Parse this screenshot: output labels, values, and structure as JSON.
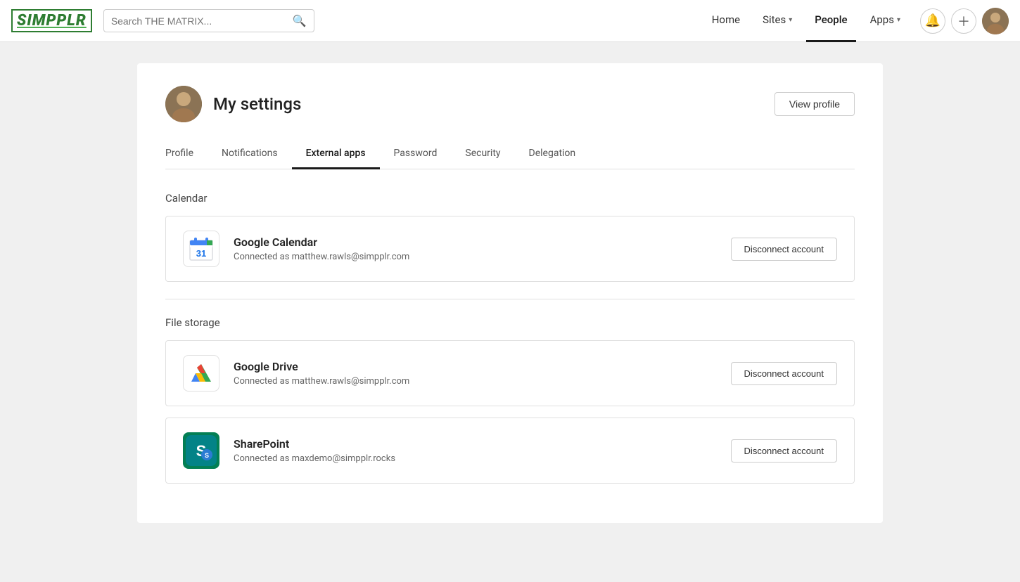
{
  "logo": {
    "text": "SIMPPLR"
  },
  "navbar": {
    "search_placeholder": "Search THE MATRIX...",
    "links": [
      {
        "id": "home",
        "label": "Home",
        "active": false,
        "has_chevron": false
      },
      {
        "id": "sites",
        "label": "Sites",
        "active": false,
        "has_chevron": true
      },
      {
        "id": "people",
        "label": "People",
        "active": true,
        "has_chevron": false
      },
      {
        "id": "apps",
        "label": "Apps",
        "active": false,
        "has_chevron": true
      }
    ]
  },
  "settings": {
    "title": "My settings",
    "view_profile_label": "View profile",
    "tabs": [
      {
        "id": "profile",
        "label": "Profile",
        "active": false
      },
      {
        "id": "notifications",
        "label": "Notifications",
        "active": false
      },
      {
        "id": "external-apps",
        "label": "External apps",
        "active": true
      },
      {
        "id": "password",
        "label": "Password",
        "active": false
      },
      {
        "id": "security",
        "label": "Security",
        "active": false
      },
      {
        "id": "delegation",
        "label": "Delegation",
        "active": false
      }
    ],
    "sections": [
      {
        "id": "calendar",
        "label": "Calendar",
        "apps": [
          {
            "id": "google-calendar",
            "name": "Google Calendar",
            "connected_as": "Connected as matthew.rawls@simpplr.com",
            "disconnect_label": "Disconnect account",
            "icon_type": "gcal"
          }
        ]
      },
      {
        "id": "file-storage",
        "label": "File storage",
        "apps": [
          {
            "id": "google-drive",
            "name": "Google Drive",
            "connected_as": "Connected as matthew.rawls@simpplr.com",
            "disconnect_label": "Disconnect account",
            "icon_type": "gdrive"
          },
          {
            "id": "sharepoint",
            "name": "SharePoint",
            "connected_as": "Connected as maxdemo@simpplr.rocks",
            "disconnect_label": "Disconnect account",
            "icon_type": "sharepoint"
          }
        ]
      }
    ]
  }
}
